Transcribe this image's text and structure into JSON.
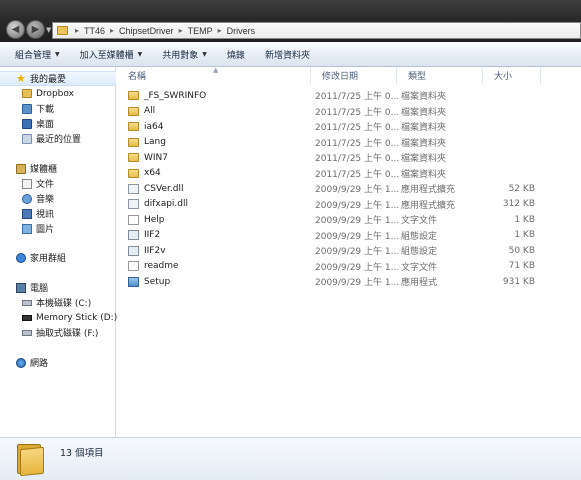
{
  "address": {
    "crumbs": [
      "TT46",
      "ChipsetDriver",
      "TEMP",
      "Drivers"
    ]
  },
  "toolbar": {
    "organize": "組合管理",
    "include_in_library": "加入至媒體櫃",
    "share_with": "共用對象",
    "burn": "燒錄",
    "new_folder": "新增資料夾"
  },
  "nav": {
    "favorites": {
      "label": "我的最愛",
      "icon": "star-icon"
    },
    "fav_items": [
      {
        "label": "Dropbox",
        "icon": "dropbox-icon"
      },
      {
        "label": "下載",
        "icon": "downloads-icon"
      },
      {
        "label": "桌面",
        "icon": "desktop-icon"
      },
      {
        "label": "最近的位置",
        "icon": "recent-places-icon"
      }
    ],
    "libraries": {
      "label": "媒體櫃",
      "icon": "library-icon"
    },
    "lib_items": [
      {
        "label": "文件",
        "icon": "documents-icon"
      },
      {
        "label": "音樂",
        "icon": "music-icon"
      },
      {
        "label": "視訊",
        "icon": "videos-icon"
      },
      {
        "label": "圖片",
        "icon": "pictures-icon"
      }
    ],
    "homegroup": {
      "label": "家用群組",
      "icon": "homegroup-icon"
    },
    "computer": {
      "label": "電腦",
      "icon": "computer-icon"
    },
    "comp_items": [
      {
        "label": "本機磁碟 (C:)",
        "icon": "local-disk-icon"
      },
      {
        "label": "Memory Stick (D:)",
        "icon": "memory-stick-icon"
      },
      {
        "label": "抽取式磁碟 (F:)",
        "icon": "removable-disk-icon"
      }
    ],
    "network": {
      "label": "網路",
      "icon": "network-icon"
    }
  },
  "columns": {
    "name": "名稱",
    "date": "修改日期",
    "type": "類型",
    "size": "大小"
  },
  "files": [
    {
      "name": "_FS_SWRINFO",
      "date": "2011/7/25 上午 0...",
      "type": "檔案資料夾",
      "size": "",
      "icon": "folder-icon"
    },
    {
      "name": "All",
      "date": "2011/7/25 上午 0...",
      "type": "檔案資料夾",
      "size": "",
      "icon": "folder-icon"
    },
    {
      "name": "ia64",
      "date": "2011/7/25 上午 0...",
      "type": "檔案資料夾",
      "size": "",
      "icon": "folder-icon"
    },
    {
      "name": "Lang",
      "date": "2011/7/25 上午 0...",
      "type": "檔案資料夾",
      "size": "",
      "icon": "folder-icon"
    },
    {
      "name": "WIN7",
      "date": "2011/7/25 上午 0...",
      "type": "檔案資料夾",
      "size": "",
      "icon": "folder-icon"
    },
    {
      "name": "x64",
      "date": "2011/7/25 上午 0...",
      "type": "檔案資料夾",
      "size": "",
      "icon": "folder-icon"
    },
    {
      "name": "CSVer.dll",
      "date": "2009/9/29 上午 1...",
      "type": "應用程式擴充",
      "size": "52 KB",
      "icon": "dll-file-icon"
    },
    {
      "name": "difxapi.dll",
      "date": "2009/9/29 上午 1...",
      "type": "應用程式擴充",
      "size": "312 KB",
      "icon": "dll-file-icon"
    },
    {
      "name": "Help",
      "date": "2009/9/29 上午 1...",
      "type": "文字文件",
      "size": "1 KB",
      "icon": "text-file-icon"
    },
    {
      "name": "IIF2",
      "date": "2009/9/29 上午 1...",
      "type": "組態設定",
      "size": "1 KB",
      "icon": "config-file-icon"
    },
    {
      "name": "IIF2v",
      "date": "2009/9/29 上午 1...",
      "type": "組態設定",
      "size": "50 KB",
      "icon": "config-file-icon"
    },
    {
      "name": "readme",
      "date": "2009/9/29 上午 1...",
      "type": "文字文件",
      "size": "71 KB",
      "icon": "text-file-icon"
    },
    {
      "name": "Setup",
      "date": "2009/9/29 上午 1...",
      "type": "應用程式",
      "size": "931 KB",
      "icon": "setup-exe-icon"
    }
  ],
  "status": {
    "item_count": "13 個項目"
  }
}
